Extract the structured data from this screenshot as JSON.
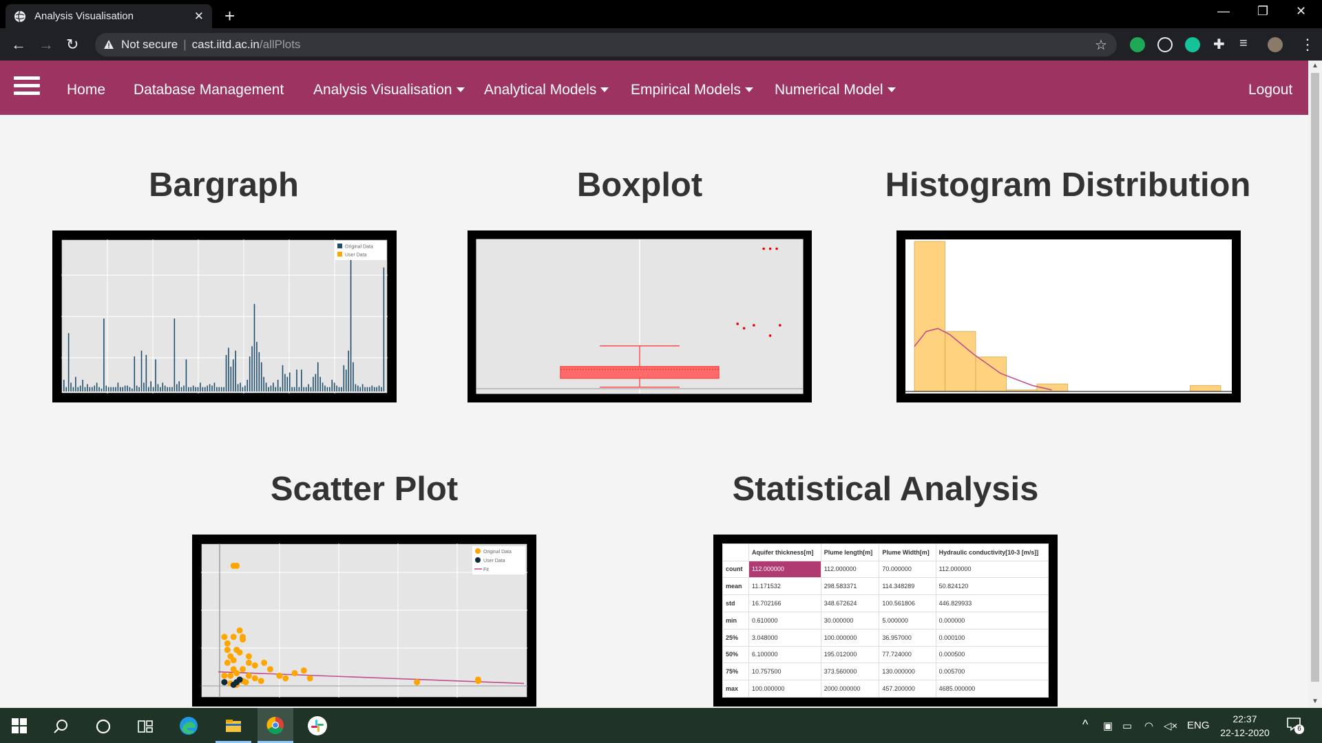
{
  "browser": {
    "tab_title": "Analysis Visualisation",
    "tab_close": "✕",
    "new_tab": "+",
    "security_label": "Not secure",
    "url_host": "cast.iitd.ac.in",
    "url_path": "/allPlots",
    "icons": [
      "globe-icon",
      "back-icon",
      "forward-icon",
      "reload-icon",
      "warning-icon",
      "star-icon",
      "extension-icon",
      "profile-avatar"
    ]
  },
  "nav": {
    "home": "Home",
    "database": "Database Management",
    "analysis": "Analysis Visualisation",
    "analytical": "Analytical Models",
    "empirical": "Empirical Models",
    "numerical": "Numerical Model",
    "logout": "Logout",
    "color": "#9c3361"
  },
  "panels": {
    "bargraph": "Bargraph",
    "boxplot": "Boxplot",
    "histogram": "Histogram Distribution",
    "scatter": "Scatter Plot",
    "statistical": "Statistical Analysis"
  },
  "chart_data": [
    {
      "type": "bar",
      "legend": [
        "Original Data",
        "User Data"
      ],
      "legend_position": "top-right",
      "colors": [
        "#1f4e6b",
        "#ffa500"
      ],
      "values": [
        8,
        3,
        40,
        6,
        3,
        10,
        3,
        4,
        8,
        3,
        5,
        3,
        3,
        4,
        6,
        3,
        2,
        50,
        4,
        3,
        3,
        3,
        3,
        6,
        3,
        3,
        4,
        4,
        3,
        2,
        24,
        4,
        3,
        28,
        6,
        25,
        3,
        7,
        3,
        22,
        5,
        3,
        6,
        4,
        3,
        3,
        3,
        50,
        5,
        7,
        3,
        4,
        22,
        3,
        3,
        4,
        3,
        3,
        6,
        3,
        3,
        4,
        5,
        4,
        6,
        3,
        3,
        3,
        3,
        25,
        30,
        17,
        22,
        28,
        5,
        6,
        3,
        4,
        8,
        24,
        31,
        60,
        34,
        27,
        20,
        10,
        6,
        3,
        4,
        6,
        3,
        8,
        3,
        18,
        12,
        10,
        13,
        3,
        3,
        15,
        3,
        15,
        3,
        3,
        5,
        3,
        10,
        12,
        20,
        10,
        6,
        4,
        3,
        3,
        8,
        6,
        4,
        3,
        3,
        18,
        15,
        28,
        99,
        20,
        5,
        4,
        3,
        5,
        3,
        3,
        3,
        4,
        3,
        3,
        4,
        3,
        85
      ],
      "grid": true
    },
    {
      "type": "box",
      "whisker_low": 2,
      "q1": 8,
      "median": 14,
      "q3": 16,
      "whisker_high": 30,
      "outliers": [
        [
          0.88,
          96
        ],
        [
          0.9,
          96
        ],
        [
          0.92,
          96
        ],
        [
          0.8,
          45
        ],
        [
          0.82,
          42
        ],
        [
          0.85,
          44
        ],
        [
          0.9,
          37
        ],
        [
          0.93,
          44
        ]
      ],
      "color": "#ff4d4d",
      "grid": true
    },
    {
      "type": "histogram",
      "bin_counts": [
        100,
        40,
        23,
        1,
        5,
        0,
        0,
        0,
        0,
        4
      ],
      "fit": [
        [
          0,
          30
        ],
        [
          0.3,
          40
        ],
        [
          0.6,
          42
        ],
        [
          0.9,
          38
        ],
        [
          1.5,
          25
        ],
        [
          2.2,
          12
        ],
        [
          3,
          4
        ],
        [
          3.5,
          1
        ]
      ],
      "bar_color": "#ffd280",
      "fit_color": "#c04c8a"
    },
    {
      "type": "scatter",
      "legend": [
        "Original Data",
        "User Data",
        "Fit"
      ],
      "legend_position": "top-right",
      "original": [
        [
          0.05,
          95
        ],
        [
          0.06,
          95
        ],
        [
          0.02,
          40
        ],
        [
          0.05,
          40
        ],
        [
          0.03,
          30
        ],
        [
          0.06,
          30
        ],
        [
          0.08,
          38
        ],
        [
          0.04,
          25
        ],
        [
          0.07,
          28
        ],
        [
          0.1,
          20
        ],
        [
          0.03,
          20
        ],
        [
          0.05,
          15
        ],
        [
          0.08,
          15
        ],
        [
          0.12,
          18
        ],
        [
          0.02,
          10
        ],
        [
          0.04,
          10
        ],
        [
          0.06,
          12
        ],
        [
          0.1,
          10
        ],
        [
          0.15,
          20
        ],
        [
          0.17,
          15
        ],
        [
          0.2,
          10
        ],
        [
          0.22,
          8
        ],
        [
          0.25,
          12
        ],
        [
          0.28,
          14
        ],
        [
          0.3,
          8
        ],
        [
          0.12,
          8
        ],
        [
          0.08,
          6
        ],
        [
          0.02,
          5
        ],
        [
          0.04,
          4
        ],
        [
          0.06,
          3
        ],
        [
          0.09,
          5
        ],
        [
          0.14,
          6
        ],
        [
          0.65,
          5
        ],
        [
          0.85,
          6
        ],
        [
          0.85,
          7
        ],
        [
          0.05,
          22
        ],
        [
          0.1,
          25
        ],
        [
          0.03,
          35
        ],
        [
          0.07,
          45
        ],
        [
          0.08,
          40
        ]
      ],
      "user": [
        [
          0.02,
          5
        ],
        [
          0.06,
          5
        ],
        [
          0.05,
          3
        ],
        [
          0.07,
          7
        ]
      ],
      "fit": [
        [
          0,
          13
        ],
        [
          1,
          4
        ]
      ],
      "grid": true
    },
    {
      "type": "table",
      "columns": [
        "",
        "Aquifer thickness[m]",
        "Plume length[m]",
        "Plume Width[m]",
        "Hydraulic conductivity[10-3 [m/s]]"
      ],
      "rows": [
        [
          "count",
          "112.000000",
          "112.000000",
          "70.000000",
          "112.000000"
        ],
        [
          "mean",
          "11.171532",
          "298.583371",
          "114.348289",
          "50.824120"
        ],
        [
          "std",
          "16.702166",
          "348.672624",
          "100.561806",
          "446.829933"
        ],
        [
          "min",
          "0.610000",
          "30.000000",
          "5.000000",
          "0.000000"
        ],
        [
          "25%",
          "3.048000",
          "100.000000",
          "36.957000",
          "0.000100"
        ],
        [
          "50%",
          "6.100000",
          "195.012000",
          "77.724000",
          "0.000500"
        ],
        [
          "75%",
          "10.757500",
          "373.560000",
          "130.000000",
          "0.005700"
        ],
        [
          "max",
          "100.000000",
          "2000.000000",
          "457.200000",
          "4685.000000"
        ]
      ]
    }
  ],
  "taskbar": {
    "lang": "ENG",
    "time": "22:37",
    "date": "22-12-2020",
    "notif_count": "6",
    "icons": [
      "windows-start-icon",
      "search-icon",
      "cortana-icon",
      "task-view-icon",
      "edge-icon",
      "file-explorer-icon",
      "chrome-icon",
      "slack-icon"
    ]
  }
}
